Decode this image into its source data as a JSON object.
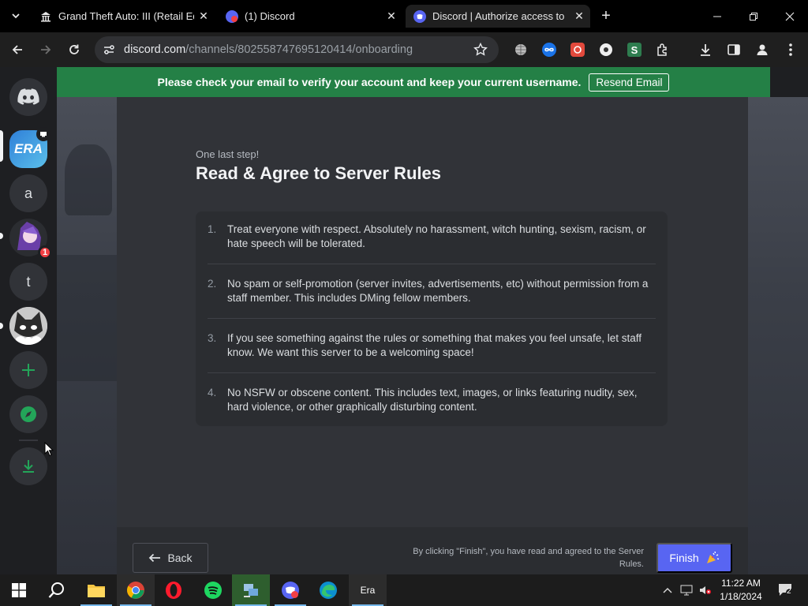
{
  "browser": {
    "tabs": [
      {
        "title": "Grand Theft Auto: III (Retail Edit",
        "close": "✕"
      },
      {
        "title": "(1) Discord",
        "close": "✕"
      },
      {
        "title": "Discord | Authorize access to yo",
        "close": "✕"
      }
    ],
    "new_tab": "+",
    "url_host": "discord.com",
    "url_path": "/channels/802558747695120414/onboarding"
  },
  "discord": {
    "guilds": [
      {
        "label": "ERA"
      },
      {
        "label": "a"
      },
      {
        "label": "t"
      }
    ],
    "badge_count": "1",
    "banner": {
      "text": "Please check your email to verify your account and keep your current username.",
      "button": "Resend Email"
    },
    "onboarding": {
      "eyebrow": "One last step!",
      "title": "Read & Agree to Server Rules",
      "rules": [
        {
          "num": "1.",
          "text": "Treat everyone with respect. Absolutely no harassment, witch hunting, sexism, racism, or hate speech will be tolerated."
        },
        {
          "num": "2.",
          "text": "No spam or self-promotion (server invites, advertisements, etc) without permission from a staff member. This includes DMing fellow members."
        },
        {
          "num": "3.",
          "text": "If you see something against the rules or something that makes you feel unsafe, let staff know. We want this server to be a welcoming space!"
        },
        {
          "num": "4.",
          "text": "No NSFW or obscene content. This includes text, images, or links featuring nudity, sex, hard violence, or other graphically disturbing content."
        }
      ],
      "back_label": "Back",
      "footer_note": "By clicking \"Finish\", you have read and agreed to the Server Rules.",
      "finish_label": "Finish"
    },
    "colors": {
      "blurple": "#5865f2",
      "banner_green": "#248046",
      "green_icon": "#23a559"
    }
  },
  "taskbar": {
    "era_label": "Era",
    "time": "11:22 AM",
    "date": "1/18/2024",
    "notification_count": "2"
  }
}
